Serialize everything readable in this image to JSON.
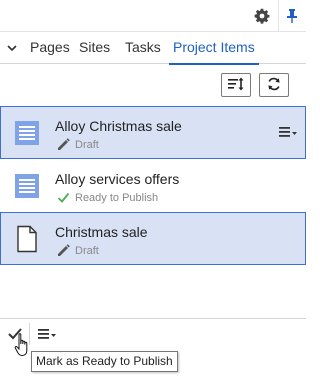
{
  "header": {
    "icons": [
      "gear-icon",
      "pin-icon"
    ]
  },
  "tabs": [
    {
      "label": "Pages",
      "active": false
    },
    {
      "label": "Sites",
      "active": false
    },
    {
      "label": "Tasks",
      "active": false
    },
    {
      "label": "Project Items",
      "active": true
    }
  ],
  "toolbar": {
    "sort_icon": "sort-icon",
    "refresh_icon": "refresh-icon"
  },
  "items": [
    {
      "title": "Alloy Christmas sale",
      "status": "Draft",
      "status_icon": "pencil-icon",
      "type_icon": "block-icon",
      "selected": true,
      "has_menu": true
    },
    {
      "title": "Alloy services offers",
      "status": "Ready to Publish",
      "status_icon": "check-icon",
      "type_icon": "block-icon",
      "selected": false,
      "has_menu": false
    },
    {
      "title": "Christmas sale",
      "status": "Draft",
      "status_icon": "pencil-icon",
      "type_icon": "page-icon",
      "selected": true,
      "has_menu": false
    }
  ],
  "bottombar": {
    "icons": [
      "check-icon",
      "menu-icon"
    ]
  },
  "tooltip": {
    "text": "Mark as Ready to Publish"
  },
  "colors": {
    "accent": "#1f61c2",
    "selected_bg": "#d9e2f5",
    "selected_border": "#3f6fd0",
    "block_icon": "#7fa3e6",
    "check_green": "#4caf50"
  }
}
